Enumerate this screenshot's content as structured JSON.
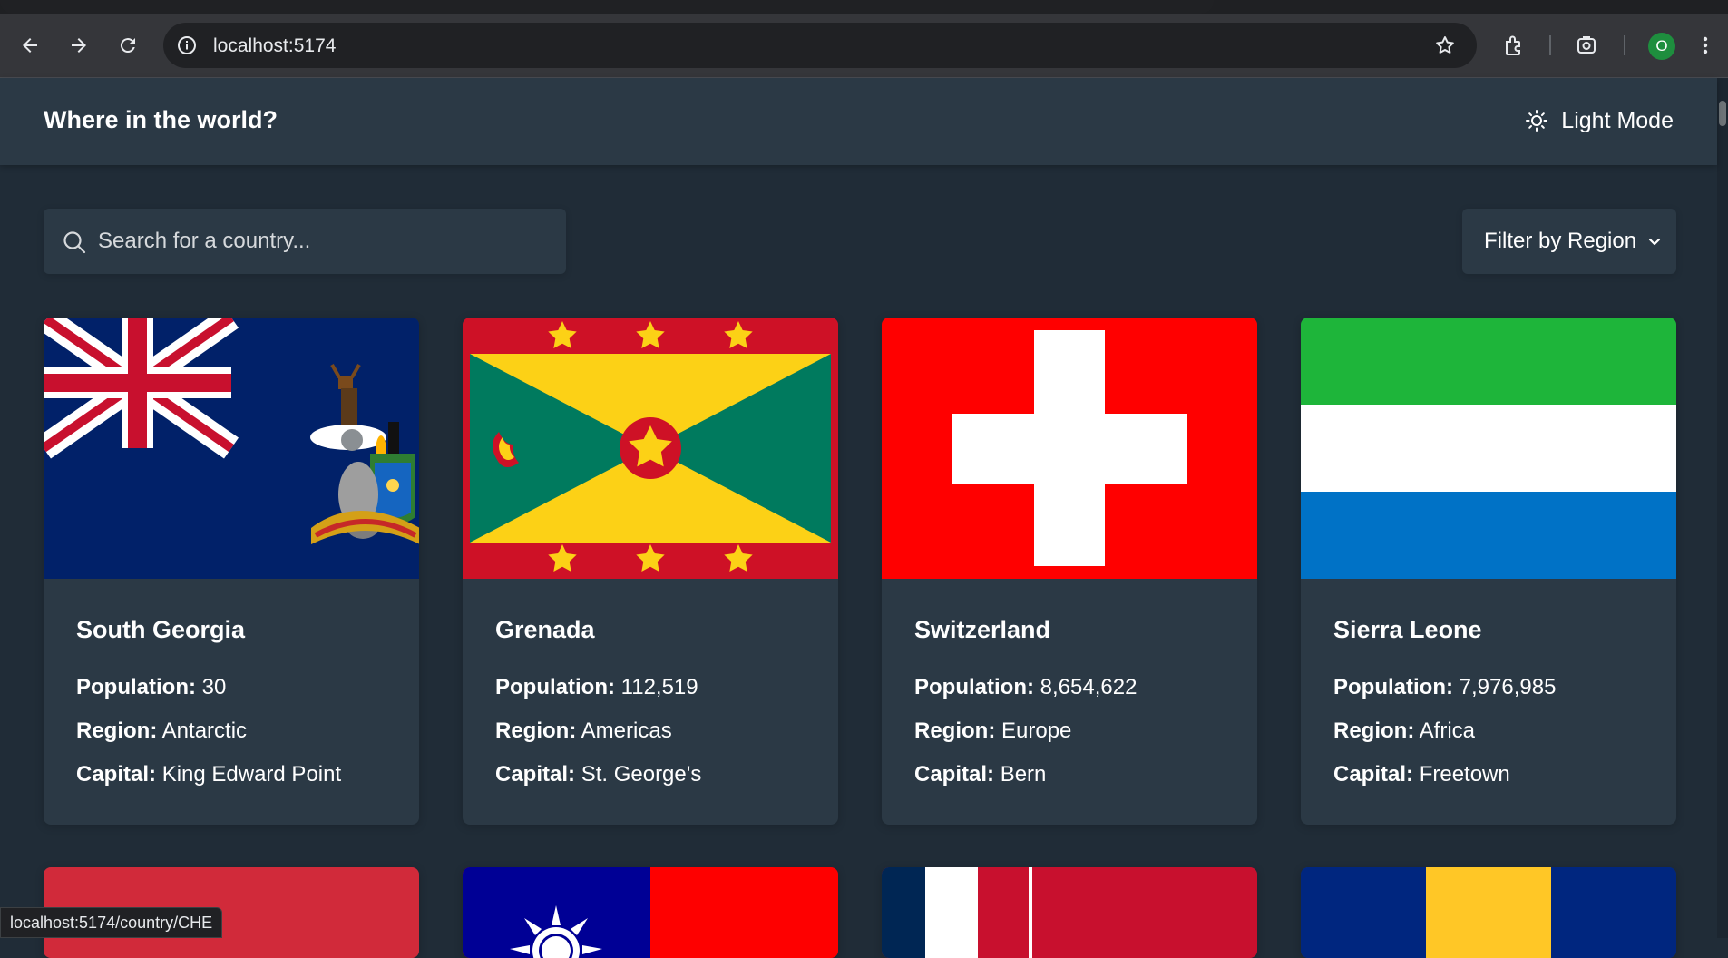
{
  "browser": {
    "url": "localhost:5174",
    "profile_initial": "O",
    "status_url": "localhost:5174/country/CHE",
    "icons": [
      "back-icon",
      "forward-icon",
      "reload-icon",
      "site-info-icon",
      "bookmark-star-icon",
      "extensions-icon",
      "screenshot-icon",
      "more-icon"
    ]
  },
  "header": {
    "title": "Where in the world?",
    "theme_label": "Light Mode"
  },
  "search": {
    "placeholder": "Search for a country..."
  },
  "filter": {
    "label": "Filter by Region"
  },
  "labels": {
    "population": "Population:",
    "region": "Region:",
    "capital": "Capital:"
  },
  "countries": [
    {
      "name": "South Georgia",
      "population": "30",
      "region": "Antarctic",
      "capital": "King Edward Point"
    },
    {
      "name": "Grenada",
      "population": "112,519",
      "region": "Americas",
      "capital": "St. George's"
    },
    {
      "name": "Switzerland",
      "population": "8,654,622",
      "region": "Europe",
      "capital": "Bern"
    },
    {
      "name": "Sierra Leone",
      "population": "7,976,985",
      "region": "Africa",
      "capital": "Freetown"
    }
  ],
  "colors": {
    "background": "#202c37",
    "element": "#2b3945",
    "text": "#ffffff"
  }
}
